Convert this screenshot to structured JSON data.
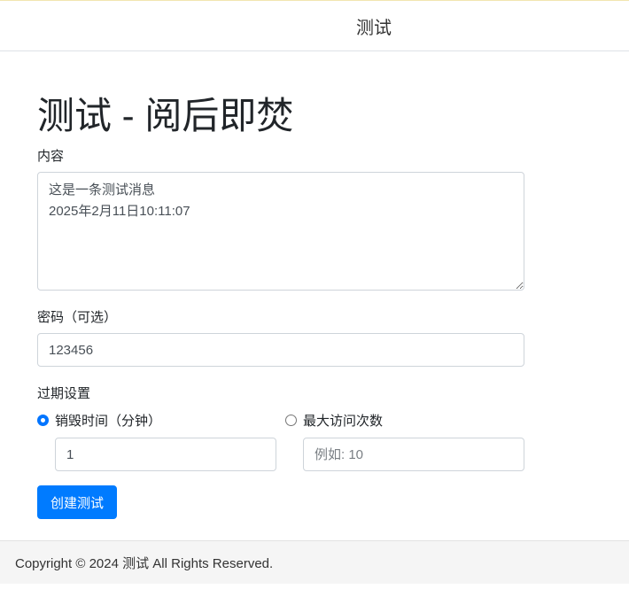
{
  "navbar": {
    "brand": "测试"
  },
  "page": {
    "title": "测试 - 阅后即焚"
  },
  "form": {
    "content_label": "内容",
    "content_value": "这是一条测试消息\n2025年2月11日10:11:07",
    "password_label": "密码（可选）",
    "password_value": "123456",
    "expiry_label": "过期设置",
    "option_time_label": "销毁时间（分钟）",
    "option_time_selected": true,
    "time_value": "1",
    "option_visits_label": "最大访问次数",
    "option_visits_selected": false,
    "visits_placeholder": "例如: 10",
    "submit_label": "创建测试"
  },
  "footer": {
    "text": "Copyright © 2024 测试 All Rights Reserved."
  }
}
